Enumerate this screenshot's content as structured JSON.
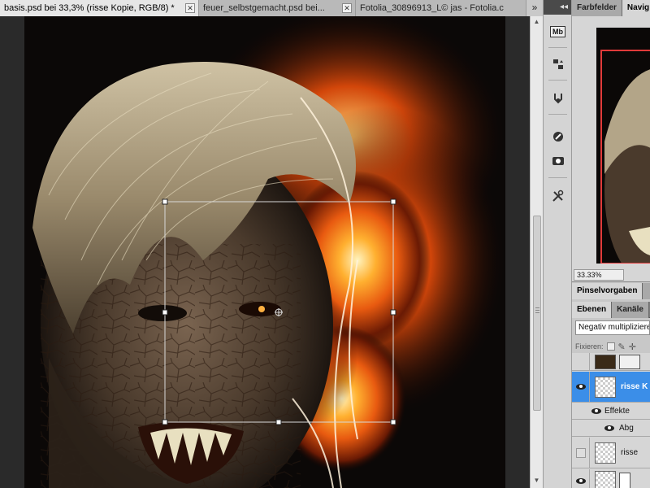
{
  "tabs": [
    {
      "label": "basis.psd bei 33,3% (risse Kopie, RGB/8) *",
      "active": true
    },
    {
      "label": "feuer_selbstgemacht.psd bei...",
      "active": false
    },
    {
      "label": "Fotolia_30896913_L© jas - Fotolia.c",
      "active": false
    }
  ],
  "tab_overflow": "»",
  "toolstrip": {
    "collapse_label": "◂◂",
    "tools": [
      "mini-bridge-icon",
      "history-icon",
      "puppet-icon",
      "brush-preset-icon",
      "clone-source-icon",
      "tools-icon"
    ],
    "mini_bridge_label": "Mb"
  },
  "panels": {
    "top_tabs": [
      {
        "label": "Farbfelder",
        "active": false
      },
      {
        "label": "Navig",
        "active": true
      }
    ],
    "nav_zoom": "33.33%",
    "brush_tabs": [
      {
        "label": "Pinselvorgaben",
        "active": true
      },
      {
        "label": "",
        "active": false
      }
    ],
    "layer_tabs": [
      {
        "label": "Ebenen",
        "active": true
      },
      {
        "label": "Kanäle",
        "active": false
      }
    ],
    "blend_mode": "Negativ multipliziere",
    "lock_label": "Fixieren:",
    "layers": [
      {
        "name": "",
        "visible": false,
        "selected": false,
        "kind": "photo"
      },
      {
        "name": "risse K",
        "visible": true,
        "selected": true,
        "kind": "transparent"
      },
      {
        "name": "Effekte",
        "visible": true,
        "selected": false,
        "kind": "effects"
      },
      {
        "name": "Abg",
        "visible": true,
        "selected": false,
        "kind": "effect-item"
      },
      {
        "name": "risse",
        "visible": false,
        "selected": false,
        "kind": "transparent"
      },
      {
        "name": "",
        "visible": true,
        "selected": false,
        "kind": "masked"
      }
    ]
  },
  "colors": {
    "ui_bg": "#c8c8c8",
    "selected_layer": "#3b8ee8",
    "transform_box": "#cccccc",
    "nav_frame": "#e03a3a"
  }
}
